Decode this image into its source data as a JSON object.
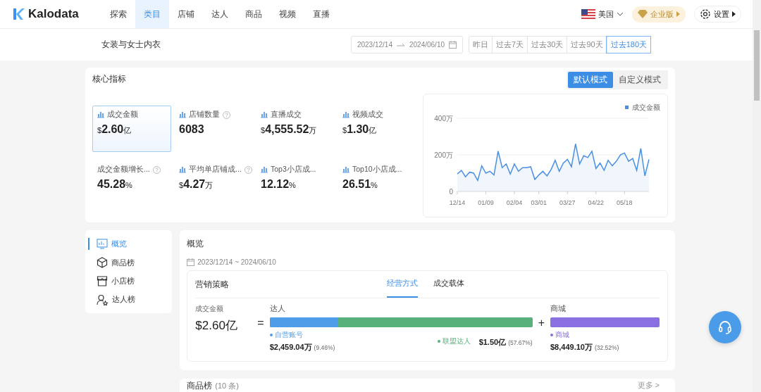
{
  "nav": {
    "logo": "Kalodata",
    "tabs": [
      {
        "label": "探索",
        "selected": false
      },
      {
        "label": "类目",
        "selected": true
      },
      {
        "label": "店铺",
        "selected": false
      },
      {
        "label": "达人",
        "selected": false
      },
      {
        "label": "商品",
        "selected": false
      },
      {
        "label": "视频",
        "selected": false
      },
      {
        "label": "直播",
        "selected": false
      }
    ],
    "region": "美国",
    "plan": "企业版",
    "settings": "设置"
  },
  "subheader": {
    "title": "女装与女士内衣",
    "date_start": "2023/12/14",
    "date_end": "2024/06/10",
    "quick_ranges": [
      {
        "label": "昨日",
        "selected": false
      },
      {
        "label": "过去7天",
        "selected": false
      },
      {
        "label": "过去30天",
        "selected": false
      },
      {
        "label": "过去90天",
        "selected": false
      },
      {
        "label": "过去180天",
        "selected": true
      }
    ]
  },
  "core": {
    "title": "核心指标",
    "modes": [
      {
        "label": "默认模式",
        "selected": true
      },
      {
        "label": "自定义模式",
        "selected": false
      }
    ],
    "metrics": [
      {
        "label": "成交金额",
        "chart_icon": true,
        "help": false,
        "prefix": "$",
        "value": "2.60",
        "unit": "亿",
        "selected": true
      },
      {
        "label": "店铺数量",
        "chart_icon": true,
        "help": true,
        "value": "6083",
        "selected": false
      },
      {
        "label": "直播成交",
        "chart_icon": true,
        "help": false,
        "prefix": "$",
        "value": "4,555.52",
        "unit": "万",
        "selected": false
      },
      {
        "label": "视频成交",
        "chart_icon": true,
        "help": false,
        "prefix": "$",
        "value": "1.30",
        "unit": "亿",
        "selected": false
      },
      {
        "label": "成交金额增长...",
        "chart_icon": false,
        "help": true,
        "value": "45.28",
        "unit": "%",
        "selected": false
      },
      {
        "label": "平均单店铺成...",
        "chart_icon": true,
        "help": true,
        "prefix": "$",
        "value": "4.27",
        "unit": "万",
        "selected": false
      },
      {
        "label": "Top3小店成...",
        "chart_icon": true,
        "help": false,
        "value": "12.12",
        "unit": "%",
        "selected": false
      },
      {
        "label": "Top10小店成...",
        "chart_icon": true,
        "help": false,
        "value": "26.51",
        "unit": "%",
        "selected": false
      }
    ],
    "chart_data": {
      "type": "area",
      "categories": [
        "12/14",
        null,
        null,
        null,
        null,
        null,
        null,
        "01/09",
        null,
        null,
        null,
        null,
        null,
        null,
        "02/04",
        null,
        null,
        null,
        null,
        null,
        "03/01",
        null,
        null,
        null,
        null,
        null,
        null,
        "03/27",
        null,
        null,
        null,
        null,
        null,
        null,
        "04/22",
        null,
        null,
        null,
        null,
        null,
        null,
        "05/18",
        null,
        null,
        null,
        null,
        null,
        null
      ],
      "series": [
        {
          "name": "成交金额",
          "color": "#4a90e2",
          "values": [
            95,
            115,
            80,
            105,
            100,
            60,
            140,
            100,
            110,
            90,
            220,
            130,
            150,
            95,
            150,
            110,
            130,
            130,
            135,
            65,
            90,
            110,
            85,
            120,
            170,
            110,
            155,
            175,
            135,
            260,
            150,
            195,
            185,
            220,
            125,
            155,
            115,
            170,
            140,
            165,
            200,
            210,
            165,
            180,
            115,
            235,
            85,
            175
          ]
        }
      ],
      "ylim": [
        0,
        400
      ],
      "yticks": [
        {
          "value": 0,
          "label": "0"
        },
        {
          "value": 200,
          "label": "200万"
        },
        {
          "value": 400,
          "label": "400万"
        }
      ]
    }
  },
  "sidebar": {
    "items": [
      {
        "label": "概览",
        "kind": "chart",
        "selected": true
      },
      {
        "label": "商品榜",
        "kind": "box",
        "selected": false
      },
      {
        "label": "小店榜",
        "kind": "store",
        "selected": false
      },
      {
        "label": "达人榜",
        "kind": "person",
        "selected": false
      }
    ]
  },
  "overview": {
    "title": "概览",
    "date_range": "2023/12/14 ~ 2024/06/10",
    "strategy": {
      "title": "营销策略",
      "tabs": [
        {
          "label": "经营方式",
          "selected": true
        },
        {
          "label": "成交载体",
          "selected": false
        }
      ],
      "total_label": "成交金额",
      "total_value": "$2.60亿",
      "equals": "=",
      "plus": "+",
      "groups": [
        {
          "label": "达人",
          "segments": [
            {
              "name": "自营账号",
              "color": "#4f9de8",
              "level": 0.26,
              "value": "$2,459.04万",
              "share": "(9.46%)"
            },
            {
              "name": "联盟达人",
              "color": "#58b07a",
              "value": "$1.50亿",
              "share": "(57.67%)"
            }
          ]
        },
        {
          "label": "商城",
          "segments": [
            {
              "name": "商城",
              "color": "#8a6fe0",
              "value": "$8,449.10万",
              "share": "(32.52%)"
            }
          ]
        }
      ]
    }
  },
  "ranking": {
    "title": "商品榜",
    "count": "(10 条)",
    "more": "更多 >"
  }
}
